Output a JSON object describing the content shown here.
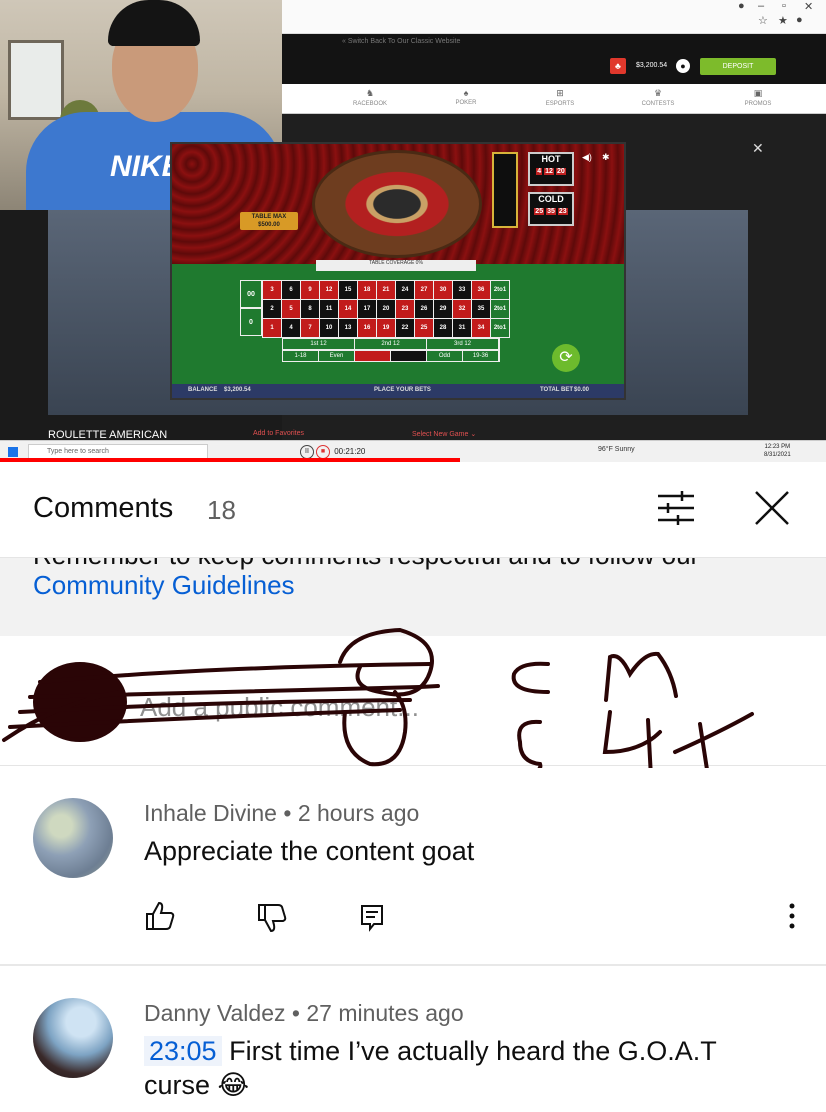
{
  "video": {
    "webcam_logo": "NIKE",
    "browser": {
      "switch_link": "« Switch Back To Our Classic Website",
      "balance": "$3,200.54",
      "deposit_label": "DEPOSIT",
      "nav": [
        "RACEBOOK",
        "POKER",
        "ESPORTS",
        "CONTESTS",
        "PROMOS"
      ],
      "game": {
        "title": "ROULETTE AMERICAN",
        "add_favorites": "Add to Favorites",
        "select_game": "Select New Game ⌄",
        "table_max_label": "TABLE MAX",
        "table_max_value": "$500.00",
        "table_coverage": "TABLE COVERAGE",
        "table_coverage_pct": "0%",
        "hot_label": "HOT",
        "hot_numbers": [
          "4",
          "12",
          "20"
        ],
        "cold_label": "COLD",
        "cold_numbers": [
          "25",
          "35",
          "23"
        ],
        "zeros": [
          "00",
          "0"
        ],
        "grid": [
          [
            "3",
            "6",
            "9",
            "12",
            "15",
            "18",
            "21",
            "24",
            "27",
            "30",
            "33",
            "36",
            "2to1"
          ],
          [
            "2",
            "5",
            "8",
            "11",
            "14",
            "17",
            "20",
            "23",
            "26",
            "29",
            "32",
            "35",
            "2to1"
          ],
          [
            "1",
            "4",
            "7",
            "10",
            "13",
            "16",
            "19",
            "22",
            "25",
            "28",
            "31",
            "34",
            "2to1"
          ]
        ],
        "dozens": [
          "1st 12",
          "2nd 12",
          "3rd 12"
        ],
        "outside": [
          "1-18",
          "Even",
          "",
          "",
          "Odd",
          "19-36"
        ],
        "balance_label": "BALANCE",
        "balance_value": "$3,200.54",
        "place_bets": "PLACE YOUR BETS",
        "total_bet_label": "TOTAL BET",
        "total_bet_value": "$0.00"
      }
    },
    "taskbar": {
      "search_placeholder": "Type here to search",
      "recording_time": "00:21:20",
      "weather": "96°F Sunny",
      "time": "12:23 PM",
      "date": "8/31/2021"
    },
    "progress_fraction": 0.557
  },
  "comments_panel": {
    "title": "Comments",
    "count": "18",
    "guidelines_prefix": "Remember to keep comments respectful and to follow our",
    "guidelines_link": "Community Guidelines",
    "add_comment_placeholder": "Add a public comment...",
    "comments": [
      {
        "author": "Inhale Divine",
        "time": "2 hours ago",
        "text": "Appreciate the content goat"
      },
      {
        "author": "Danny Valdez",
        "time": "27 minutes ago",
        "timestamp": "23:05",
        "text": "First time I’ve actually heard the G.O.A.T curse 😂"
      }
    ]
  },
  "colors": {
    "link_blue": "#065fd4",
    "progress_red": "#ff0000",
    "deposit_green": "#7dbb2b"
  }
}
